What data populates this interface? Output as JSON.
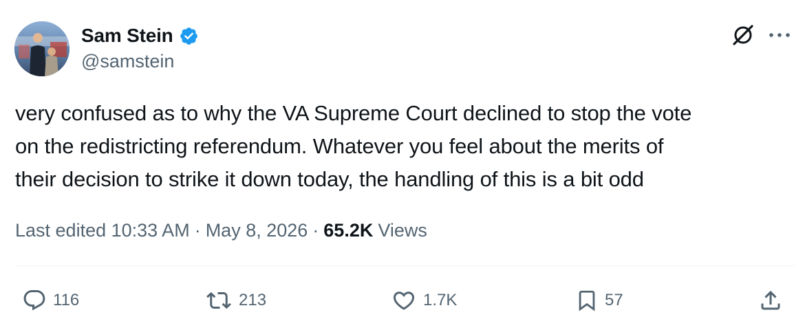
{
  "author": {
    "display_name": "Sam Stein",
    "handle": "@samstein",
    "verified": true,
    "verified_color": "#1d9bf0"
  },
  "tweet": {
    "lines": [
      "very confused as to why the VA Supreme Court declined to stop the vote",
      "on the redistricting referendum. Whatever you feel about the merits of",
      "their decision to strike it down today, the handling of this is a bit odd"
    ]
  },
  "meta": {
    "edited_label": "Last edited 10:33 AM",
    "separator": "·",
    "date": "May 8, 2026",
    "views_count": "65.2K",
    "views_label": "Views"
  },
  "actions": {
    "replies": "116",
    "reposts": "213",
    "likes": "1.7K",
    "bookmarks": "57"
  },
  "icons": {
    "grok": "grok-icon",
    "more": "more-icon",
    "reply": "reply-icon",
    "repost": "repost-icon",
    "like": "like-icon",
    "bookmark": "bookmark-icon",
    "share": "share-icon"
  },
  "colors": {
    "text_primary": "#0f1419",
    "text_secondary": "#536471",
    "divider": "#eff3f4"
  }
}
